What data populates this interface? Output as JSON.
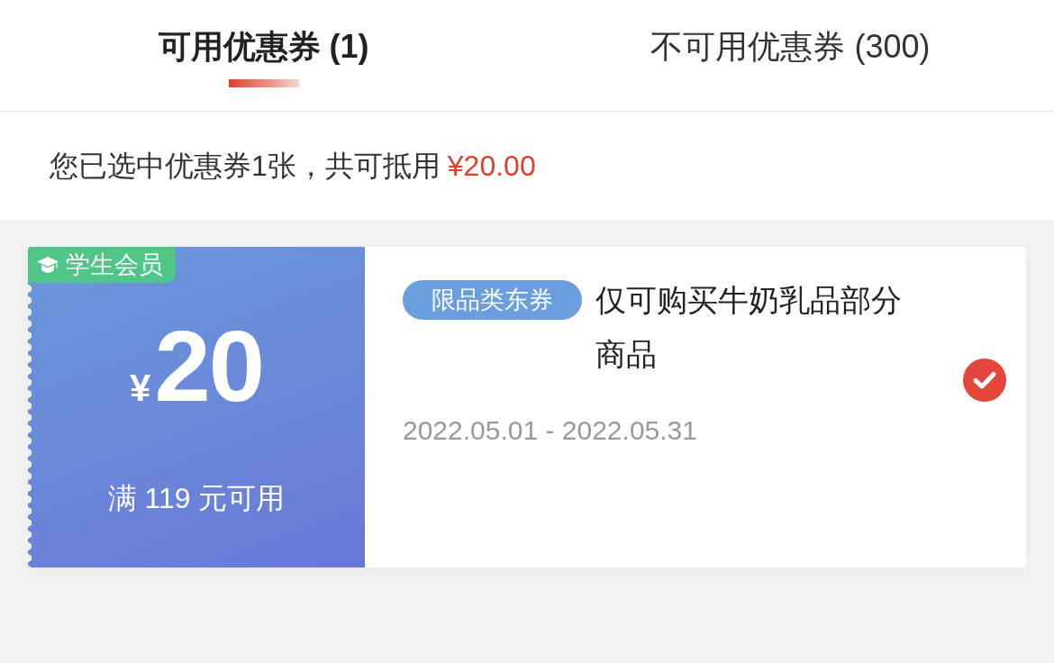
{
  "tabs": [
    {
      "label": "可用优惠券 (1)",
      "selected": true
    },
    {
      "label": "不可用优惠券 (300)",
      "selected": false
    }
  ],
  "summary": {
    "text": "您已选中优惠券1张，共可抵用",
    "amount": "¥20.00"
  },
  "coupons": [
    {
      "badge": "学生会员",
      "currency": "¥",
      "value": "20",
      "condition": "满 119 元可用",
      "tag": "限品类东券",
      "title": "仅可购买牛奶乳品部分商品",
      "validity": "2022.05.01 - 2022.05.31",
      "selected": true
    }
  ]
}
